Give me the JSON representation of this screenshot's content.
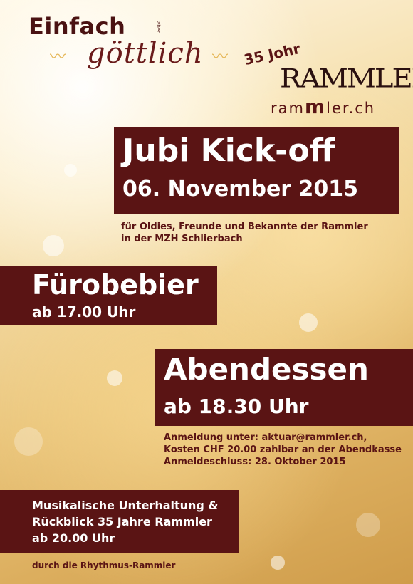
{
  "logo": {
    "einfach": "Einfach",
    "aber": "aber",
    "goettlich": "göttlich"
  },
  "anniversary": {
    "label": "35 Johr",
    "brand": "RAMMLER",
    "url_prefix": "ram",
    "url_mm": "m",
    "url_suffix": "ler.ch"
  },
  "headline": {
    "title": "Jubi Kick-off",
    "date": "06. November 2015"
  },
  "intro": {
    "line1": "für Oldies, Freunde und Bekannte der Rammler",
    "line2": "in der MZH Schlierbach"
  },
  "fuerobebier": {
    "title": "Fürobebier",
    "time": "ab 17.00 Uhr"
  },
  "abendessen": {
    "title": "Abendessen",
    "time": "ab 18.30 Uhr",
    "info1": "Anmeldung unter: aktuar@rammler.ch,",
    "info2": "Kosten CHF 20.00 zahlbar an der Abendkasse",
    "info3": "Anmeldeschluss: 28. Oktober 2015"
  },
  "musik": {
    "line1": "Musikalische Unterhaltung &",
    "line2": "Rückblick 35 Jahre Rammler",
    "line3": "ab 20.00 Uhr",
    "credit": "durch die Rhythmus-Rammler"
  },
  "colors": {
    "maroon": "#5a1414",
    "gold": "#e9c47a"
  }
}
